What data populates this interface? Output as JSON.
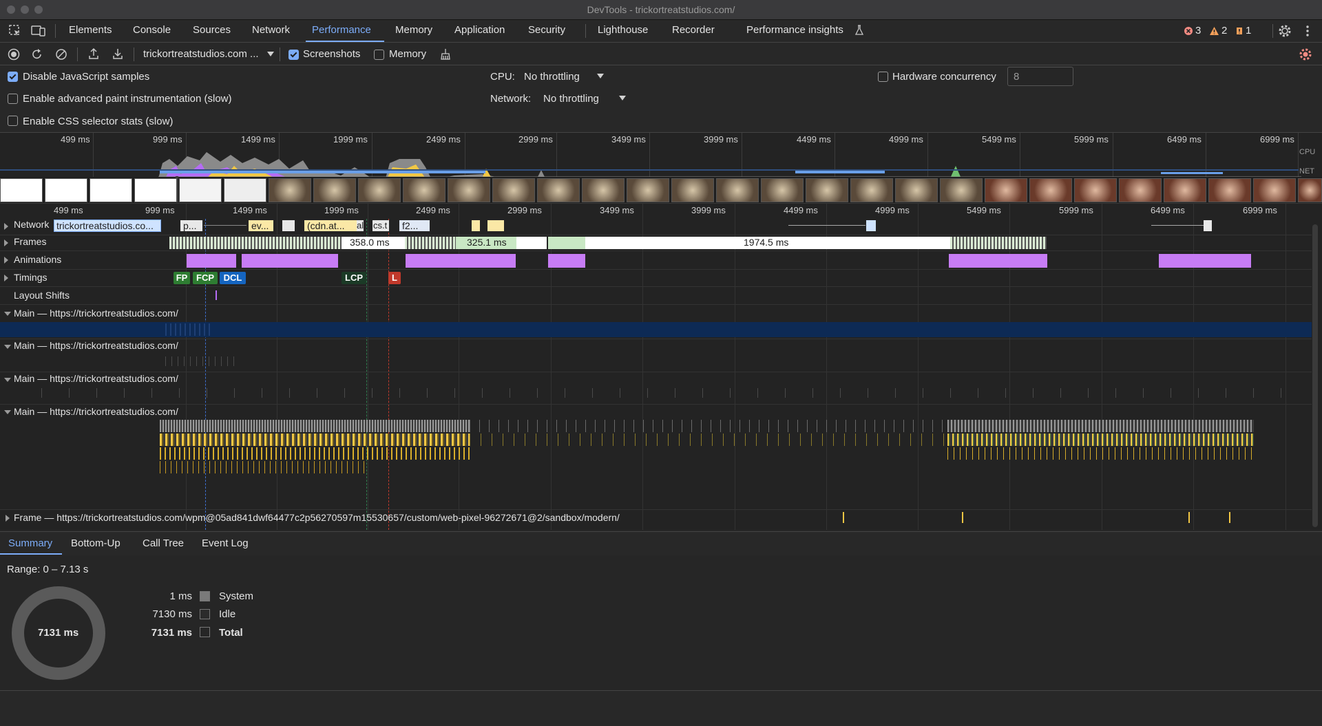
{
  "window": {
    "title": "DevTools - trickortreatstudios.com/"
  },
  "tabs": [
    "Elements",
    "Console",
    "Sources",
    "Network",
    "Performance",
    "Memory",
    "Application",
    "Security",
    "Lighthouse",
    "Recorder",
    "Performance insights"
  ],
  "active_tab": "Performance",
  "issues": {
    "errors": "3",
    "warnings": "2",
    "info": "1"
  },
  "toolbar": {
    "recording_select": "trickortreatstudios.com ...",
    "screenshots_label": "Screenshots",
    "screenshots_checked": true,
    "memory_label": "Memory",
    "memory_checked": false
  },
  "settings": {
    "disable_js_samples": "Disable JavaScript samples",
    "advanced_paint": "Enable advanced paint instrumentation (slow)",
    "css_selector_stats": "Enable CSS selector stats (slow)",
    "cpu_label": "CPU:",
    "cpu_value": "No throttling",
    "network_label": "Network:",
    "network_value": "No throttling",
    "hw_concurrency_label": "Hardware concurrency",
    "hw_concurrency_value": "8"
  },
  "overview": {
    "ticks": [
      "499 ms",
      "999 ms",
      "1499 ms",
      "1999 ms",
      "2499 ms",
      "2999 ms",
      "3499 ms",
      "3999 ms",
      "4499 ms",
      "4999 ms",
      "5499 ms",
      "5999 ms",
      "6499 ms",
      "6999 ms"
    ],
    "cpu_label": "CPU",
    "net_label": "NET"
  },
  "flame_ticks": [
    "499 ms",
    "999 ms",
    "1499 ms",
    "1999 ms",
    "2499 ms",
    "2999 ms",
    "3499 ms",
    "3999 ms",
    "4499 ms",
    "4999 ms",
    "5499 ms",
    "5999 ms",
    "6499 ms",
    "6999 ms"
  ],
  "tracks": {
    "network": "Network",
    "network_items": [
      "trickortreatstudios.co...",
      "p...",
      "ev...",
      "(cdn.at...",
      "al",
      "cs.t",
      "f2..."
    ],
    "frames": "Frames",
    "frame_durations": [
      "358.0 ms",
      "325.1 ms",
      "1974.5 ms"
    ],
    "animations": "Animations",
    "timings": "Timings",
    "timing_markers": [
      "FP",
      "FCP",
      "DCL",
      "LCP",
      "L"
    ],
    "layout_shifts": "Layout Shifts",
    "main1": "Main — https://trickortreatstudios.com/",
    "main2": "Main — https://trickortreatstudios.com/",
    "main3": "Main — https://trickortreatstudios.com/",
    "main4": "Main — https://trickortreatstudios.com/",
    "frame_track": "Frame — https://trickortreatstudios.com/wpm@05ad841dwf64477c2p56270597m15530657/custom/web-pixel-96272671@2/sandbox/modern/"
  },
  "bottom_tabs": [
    "Summary",
    "Bottom-Up",
    "Call Tree",
    "Event Log"
  ],
  "summary": {
    "range": "Range: 0 – 7.13 s",
    "donut_label": "7131 ms",
    "rows": [
      {
        "value": "1 ms",
        "label": "System"
      },
      {
        "value": "7130 ms",
        "label": "Idle"
      },
      {
        "value": "7131 ms",
        "label": "Total"
      }
    ]
  },
  "colors": {
    "accent": "#7cacf8",
    "scripting": "#f2c744",
    "rendering": "#b56cf5",
    "painting": "#6fbf6f",
    "system": "#8a8a8a"
  }
}
